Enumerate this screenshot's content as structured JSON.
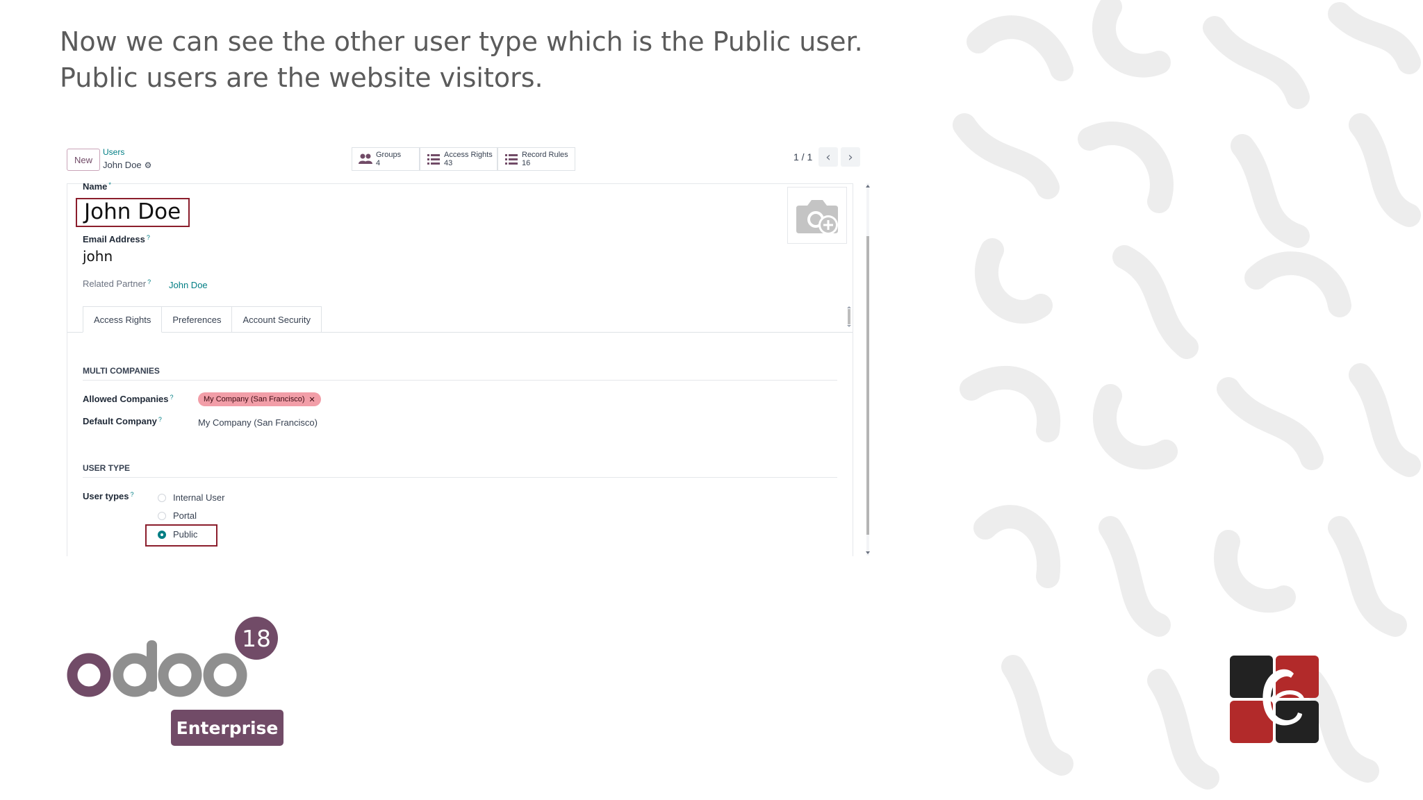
{
  "caption": "Now we can see the other user type which is the Public user. Public users are the website visitors.",
  "control_panel": {
    "new_button": "New",
    "breadcrumb_parent": "Users",
    "breadcrumb_current": "John Doe",
    "smart_buttons": [
      {
        "label": "Groups",
        "count": "4",
        "icon": "users-icon"
      },
      {
        "label": "Access Rights",
        "count": "43",
        "icon": "list-icon"
      },
      {
        "label": "Record Rules",
        "count": "16",
        "icon": "list-icon"
      }
    ],
    "pager": "1 / 1"
  },
  "form": {
    "name_label": "Name",
    "name_required_mark": "*",
    "name_value": "John Doe",
    "email_label": "Email Address",
    "email_value": "john",
    "related_partner_label": "Related Partner",
    "related_partner_value": "John Doe",
    "help_mark": "?",
    "tabs": [
      {
        "label": "Access Rights",
        "active": true
      },
      {
        "label": "Preferences",
        "active": false
      },
      {
        "label": "Account Security",
        "active": false
      }
    ],
    "multi_companies_title": "MULTI COMPANIES",
    "allowed_companies_label": "Allowed Companies",
    "allowed_companies_tag": "My Company (San Francisco)",
    "default_company_label": "Default Company",
    "default_company_value": "My Company (San Francisco)",
    "user_type_title": "USER TYPE",
    "user_types_label": "User types",
    "user_types": [
      {
        "label": "Internal User",
        "selected": false
      },
      {
        "label": "Portal",
        "selected": false
      },
      {
        "label": "Public",
        "selected": true
      }
    ]
  },
  "branding": {
    "version": "18",
    "edition": "Enterprise",
    "accent_color": "#714B67",
    "highlight_color": "#8b1d2c",
    "link_color": "#017e84"
  }
}
